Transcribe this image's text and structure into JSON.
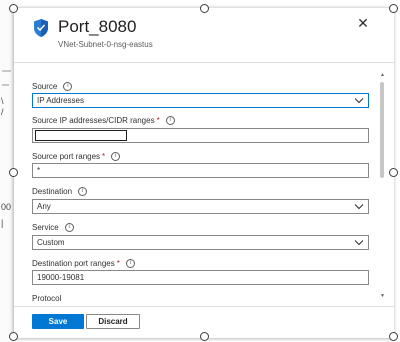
{
  "panel": {
    "title": "Port_8080",
    "subtitle": "VNet-Subnet-0-nsg-eastus",
    "close_glyph": "✕"
  },
  "form": {
    "source": {
      "label": "Source",
      "value": "IP Addresses"
    },
    "source_ip": {
      "label": "Source IP addresses/CIDR ranges",
      "required_mark": "*",
      "value": ""
    },
    "source_port": {
      "label": "Source port ranges",
      "required_mark": "*",
      "value": "*"
    },
    "destination": {
      "label": "Destination",
      "value": "Any"
    },
    "service": {
      "label": "Service",
      "value": "Custom"
    },
    "dest_port": {
      "label": "Destination port ranges",
      "required_mark": "*",
      "value": "19000-19081"
    },
    "protocol": {
      "label": "Protocol"
    },
    "info_glyph": "i"
  },
  "footer": {
    "save_label": "Save",
    "discard_label": "Discard"
  },
  "background": {
    "text_1": "\\",
    "text_2": "/",
    "text_3": "00",
    "text_4": "|"
  },
  "icons": {
    "panel": "shield-icon",
    "dropdown": "chevron-down-icon",
    "close": "close-icon",
    "info": "info-icon"
  },
  "colors": {
    "accent": "#0078d4",
    "required": "#a4262c",
    "shield_blue": "#2b7cd3"
  }
}
